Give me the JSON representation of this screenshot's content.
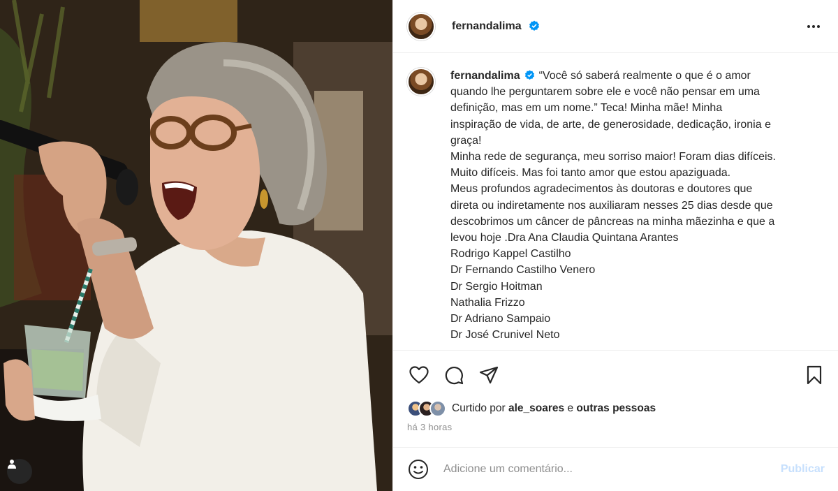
{
  "post": {
    "username": "fernandalima",
    "verified_icon": "verified-badge-icon",
    "more_icon": "more-options-icon"
  },
  "caption": {
    "username": "fernandalima",
    "lines": [
      "“Você só saberá realmente o que é o amor",
      "quando lhe perguntarem sobre ele e você não pensar em uma",
      "definição, mas em um nome.” Teca! Minha mãe! Minha",
      "inspiração de vida, de arte, de generosidade, dedicação, ironia e",
      "graça!",
      "Minha rede de segurança, meu sorriso maior! Foram dias difíceis.",
      "Muito difíceis. Mas foi tanto amor que estou apaziguada.",
      "Meus profundos agradecimentos às doutoras e doutores que",
      "direta ou indiretamente nos auxiliaram nesses 25 dias desde que",
      "descobrimos um câncer de pâncreas na minha mãezinha e que a",
      "levou hoje .Dra Ana Claudia Quintana Arantes",
      "Rodrigo Kappel Castilho",
      "Dr Fernando Castilho Venero",
      "Dr Sergio Hoitman",
      "Nathalia Frizzo",
      "Dr Adriano Sampaio",
      "Dr José Crunivel Neto"
    ]
  },
  "actions": {
    "like_icon": "heart-icon",
    "comment_icon": "comment-icon",
    "share_icon": "share-icon",
    "save_icon": "bookmark-icon"
  },
  "likes": {
    "prefix": "Curtido por",
    "user": "ale_soares",
    "connector": "e",
    "suffix": "outras pessoas"
  },
  "timestamp": "há 3 horas",
  "comment": {
    "placeholder": "Adicione um comentário...",
    "publish_label": "Publicar",
    "emoji_icon": "emoji-icon"
  },
  "colors": {
    "text": "#262626",
    "secondary": "#8e8e8e",
    "verified": "#0095f6",
    "publish_disabled": "#c7e0fd",
    "border": "#efefef"
  }
}
